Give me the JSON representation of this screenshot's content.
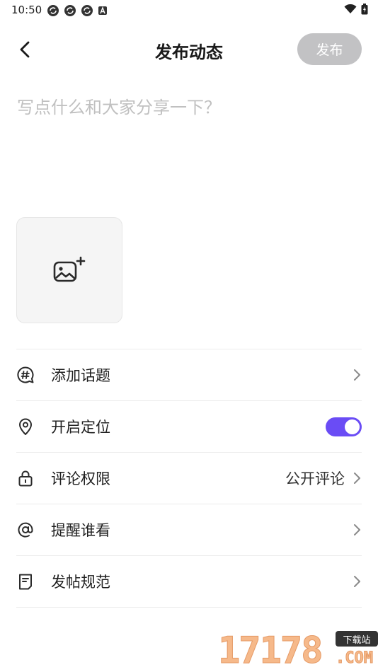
{
  "status_bar": {
    "time": "10:50",
    "icons_left": [
      "sync-icon",
      "sync-icon",
      "sync-icon",
      "a-icon"
    ],
    "icons_right": [
      "wifi-icon",
      "battery-icon"
    ]
  },
  "header": {
    "back_icon": "chevron-left-icon",
    "title": "发布动态",
    "publish_label": "发布"
  },
  "composer": {
    "placeholder": "写点什么和大家分享一下？",
    "value": ""
  },
  "image_picker": {
    "icon": "add-image-icon"
  },
  "settings": {
    "topic": {
      "icon": "hashtag-bubble-icon",
      "label": "添加话题"
    },
    "location": {
      "icon": "location-pin-icon",
      "label": "开启定位",
      "enabled": true
    },
    "comment": {
      "icon": "lock-icon",
      "label": "评论权限",
      "value": "公开评论"
    },
    "mention": {
      "icon": "at-icon",
      "label": "提醒谁看"
    },
    "rules": {
      "icon": "document-icon",
      "label": "发帖规范"
    }
  },
  "watermark": {
    "digits": "17178",
    "badge": "下载站",
    "suffix": ".COM"
  },
  "colors": {
    "accent": "#6a4cf5",
    "publish_disabled": "#c2c2c4",
    "placeholder": "#c0c0c0"
  }
}
